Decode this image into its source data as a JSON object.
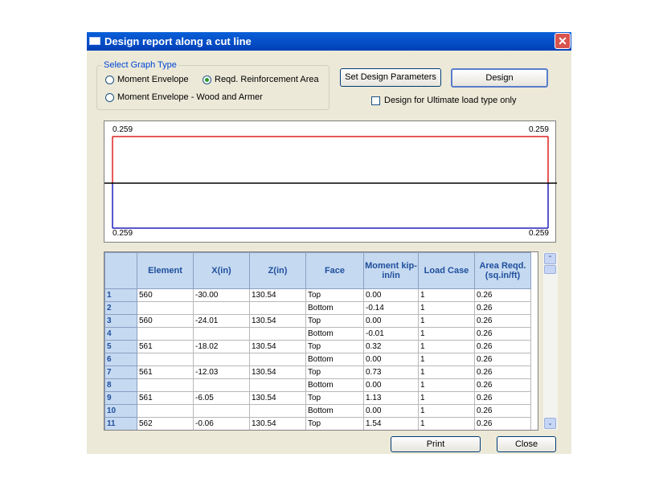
{
  "window": {
    "title": "Design report along a cut line",
    "close_glyph": "✕"
  },
  "graph_type": {
    "legend": "Select Graph Type",
    "options": [
      {
        "label": "Moment Envelope",
        "selected": false
      },
      {
        "label": "Reqd. Reinforcement Area",
        "selected": true
      },
      {
        "label": "Moment Envelope - Wood and Armer",
        "selected": false
      }
    ]
  },
  "buttons": {
    "set_params": "Set Design Parameters",
    "design": "Design",
    "print": "Print",
    "close": "Close"
  },
  "ultimate_checkbox": {
    "label": "Design for Ultimate load type only",
    "checked": false
  },
  "graph": {
    "top_left": "0.259",
    "top_right": "0.259",
    "bottom_left": "0.259",
    "bottom_right": "0.259",
    "colors": {
      "top_line": "#e02020",
      "bottom_line": "#2020c0",
      "axis": "#000000"
    }
  },
  "table": {
    "headers": [
      "",
      "Element",
      "X(in)",
      "Z(in)",
      "Face",
      "Moment kip-in/in",
      "Load Case",
      "Area Reqd.(sq.in/ft)"
    ],
    "rows": [
      [
        "1",
        "560",
        "-30.00",
        "130.54",
        "Top",
        "0.00",
        "1",
        "0.26"
      ],
      [
        "2",
        "",
        "",
        "",
        "Bottom",
        "-0.14",
        "1",
        "0.26"
      ],
      [
        "3",
        "560",
        "-24.01",
        "130.54",
        "Top",
        "0.00",
        "1",
        "0.26"
      ],
      [
        "4",
        "",
        "",
        "",
        "Bottom",
        "-0.01",
        "1",
        "0.26"
      ],
      [
        "5",
        "561",
        "-18.02",
        "130.54",
        "Top",
        "0.32",
        "1",
        "0.26"
      ],
      [
        "6",
        "",
        "",
        "",
        "Bottom",
        "0.00",
        "1",
        "0.26"
      ],
      [
        "7",
        "561",
        "-12.03",
        "130.54",
        "Top",
        "0.73",
        "1",
        "0.26"
      ],
      [
        "8",
        "",
        "",
        "",
        "Bottom",
        "0.00",
        "1",
        "0.26"
      ],
      [
        "9",
        "561",
        "-6.05",
        "130.54",
        "Top",
        "1.13",
        "1",
        "0.26"
      ],
      [
        "10",
        "",
        "",
        "",
        "Bottom",
        "0.00",
        "1",
        "0.26"
      ],
      [
        "11",
        "562",
        "-0.06",
        "130.54",
        "Top",
        "1.54",
        "1",
        "0.26"
      ]
    ]
  },
  "scrollbar": {
    "up_glyph": "⌃",
    "down_glyph": "⌄"
  }
}
